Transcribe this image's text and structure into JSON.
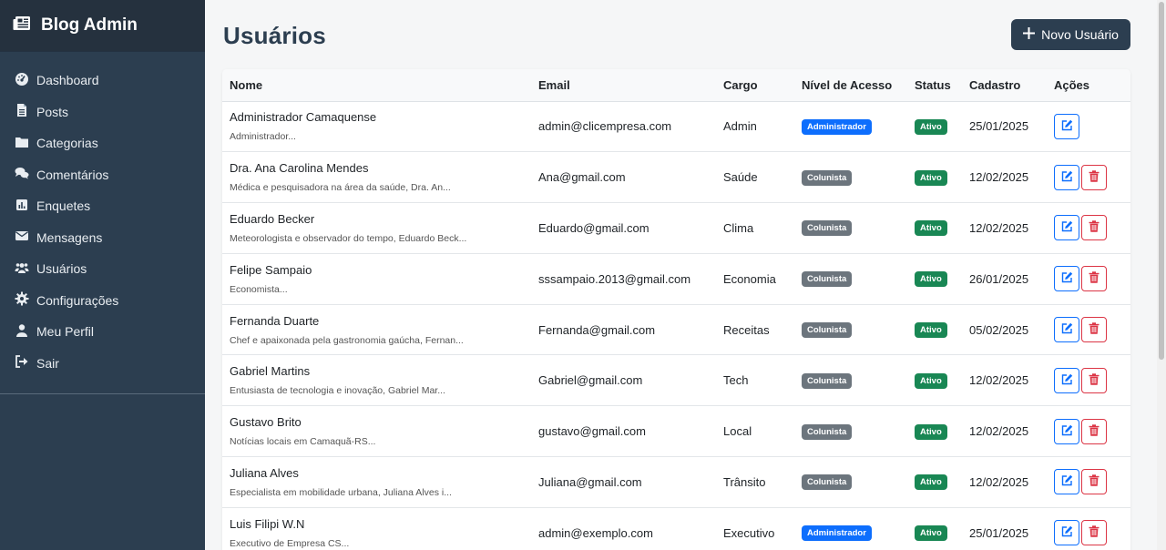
{
  "sidebar": {
    "brand": "Blog Admin",
    "brand_icon": "newspaper-icon",
    "items": [
      {
        "label": "Dashboard",
        "icon": "speedometer-icon"
      },
      {
        "label": "Posts",
        "icon": "file-icon"
      },
      {
        "label": "Categorias",
        "icon": "folder-icon"
      },
      {
        "label": "Comentários",
        "icon": "comments-icon"
      },
      {
        "label": "Enquetes",
        "icon": "poll-icon"
      },
      {
        "label": "Mensagens",
        "icon": "envelope-icon"
      },
      {
        "label": "Usuários",
        "icon": "users-icon"
      },
      {
        "label": "Configurações",
        "icon": "gear-icon"
      },
      {
        "label": "Meu Perfil",
        "icon": "user-icon"
      },
      {
        "label": "Sair",
        "icon": "sign-out-icon"
      }
    ]
  },
  "header": {
    "title": "Usuários",
    "new_button": "Novo Usuário"
  },
  "table": {
    "columns": [
      "Nome",
      "Email",
      "Cargo",
      "Nível de Acesso",
      "Status",
      "Cadastro",
      "Ações"
    ],
    "rows": [
      {
        "name": "Administrador Camaquense",
        "desc": "Administrador...",
        "email": "admin@clicempresa.com",
        "cargo": "Admin",
        "nivel": "Administrador",
        "status": "Ativo",
        "cadastro": "25/01/2025",
        "can_delete": false
      },
      {
        "name": "Dra. Ana Carolina Mendes",
        "desc": "Médica e pesquisadora na área da saúde, Dra. An...",
        "email": "Ana@gmail.com",
        "cargo": "Saúde",
        "nivel": "Colunista",
        "status": "Ativo",
        "cadastro": "12/02/2025",
        "can_delete": true
      },
      {
        "name": "Eduardo Becker",
        "desc": "Meteorologista e observador do tempo, Eduardo Beck...",
        "email": "Eduardo@gmail.com",
        "cargo": "Clima",
        "nivel": "Colunista",
        "status": "Ativo",
        "cadastro": "12/02/2025",
        "can_delete": true
      },
      {
        "name": "Felipe Sampaio",
        "desc": "Economista...",
        "email": "sssampaio.2013@gmail.com",
        "cargo": "Economia",
        "nivel": "Colunista",
        "status": "Ativo",
        "cadastro": "26/01/2025",
        "can_delete": true
      },
      {
        "name": "Fernanda Duarte",
        "desc": "Chef e apaixonada pela gastronomia gaúcha, Fernan...",
        "email": "Fernanda@gmail.com",
        "cargo": "Receitas",
        "nivel": "Colunista",
        "status": "Ativo",
        "cadastro": "05/02/2025",
        "can_delete": true
      },
      {
        "name": "Gabriel Martins",
        "desc": "Entusiasta de tecnologia e inovação, Gabriel Mar...",
        "email": "Gabriel@gmail.com",
        "cargo": "Tech",
        "nivel": "Colunista",
        "status": "Ativo",
        "cadastro": "12/02/2025",
        "can_delete": true
      },
      {
        "name": "Gustavo Brito",
        "desc": "Notícias locais em Camaquã-RS...",
        "email": "gustavo@gmail.com",
        "cargo": "Local",
        "nivel": "Colunista",
        "status": "Ativo",
        "cadastro": "12/02/2025",
        "can_delete": true
      },
      {
        "name": "Juliana Alves",
        "desc": "Especialista em mobilidade urbana, Juliana Alves i...",
        "email": "Juliana@gmail.com",
        "cargo": "Trânsito",
        "nivel": "Colunista",
        "status": "Ativo",
        "cadastro": "12/02/2025",
        "can_delete": true
      },
      {
        "name": "Luis Filipi W.N",
        "desc": "Executivo de Empresa CS...",
        "email": "admin@exemplo.com",
        "cargo": "Executivo",
        "nivel": "Administrador",
        "status": "Ativo",
        "cadastro": "25/01/2025",
        "can_delete": true
      }
    ]
  },
  "colors": {
    "sidebar_bg": "#2c3e50",
    "admin_badge": "#0d6efd",
    "colunista_badge": "#6c757d",
    "status_active": "#198754",
    "delete": "#dc3545"
  }
}
